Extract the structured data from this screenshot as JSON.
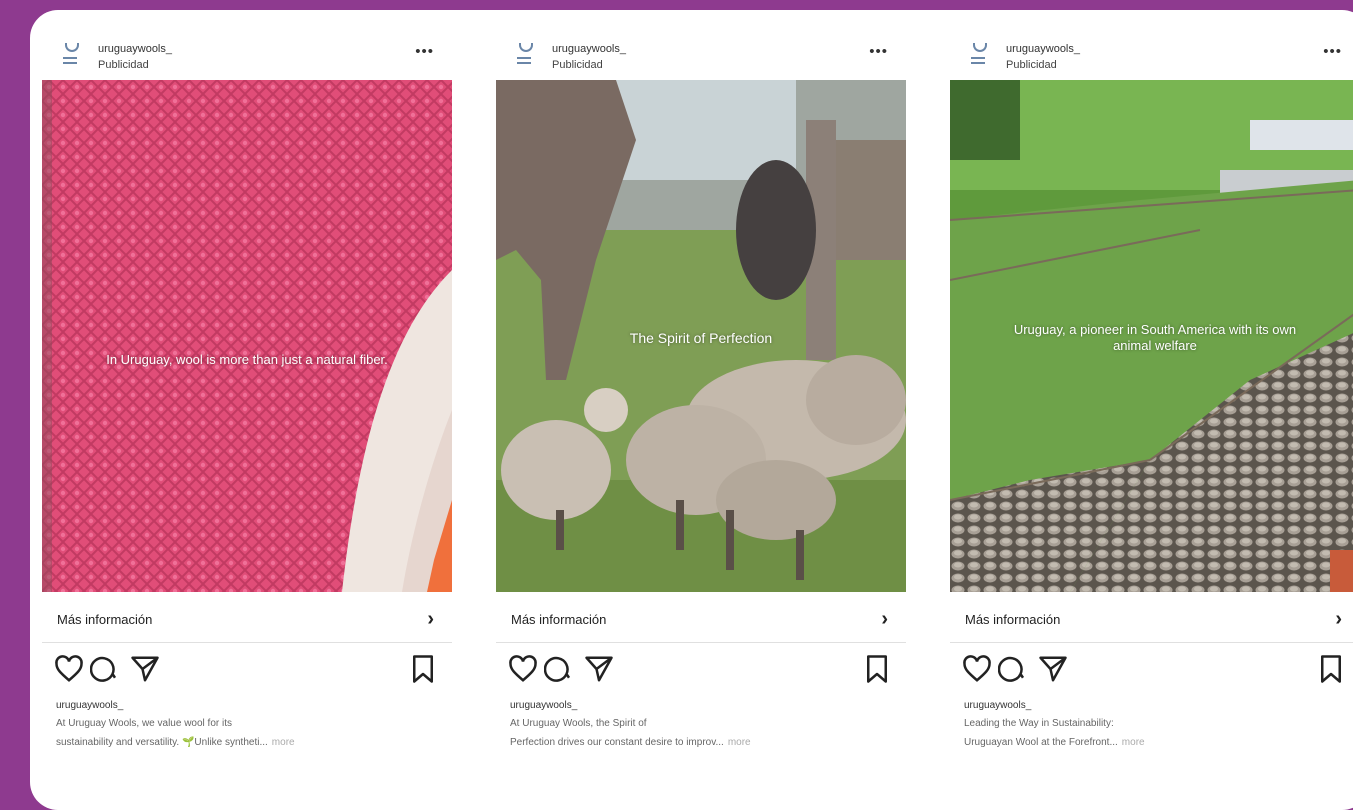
{
  "posts": [
    {
      "username": "uruguaywools_",
      "sponsored": "Publicidad",
      "overlay": "In Uruguay, wool is more than just a natural fiber.",
      "cta": "Más información",
      "caption_user": "uruguaywools_",
      "caption_line1": "At Uruguay Wools, we value wool for its",
      "caption_line2": "sustainability and versatility. 🌱Unlike syntheti...",
      "more": "more"
    },
    {
      "username": "uruguaywools_",
      "sponsored": "Publicidad",
      "overlay": "The Spirit of Perfection",
      "cta": "Más información",
      "caption_user": "uruguaywools_",
      "caption_line1": "At Uruguay Wools, the Spirit of",
      "caption_line2": "Perfection drives our constant desire to improv...",
      "more": "more"
    },
    {
      "username": "uruguaywools_",
      "sponsored": "Publicidad",
      "overlay": "Uruguay, a pioneer in South America with its own animal welfare",
      "cta": "Más información",
      "caption_user": "uruguaywools_",
      "caption_line1": "Leading the Way in Sustainability:",
      "caption_line2": "Uruguayan Wool at the Forefront...",
      "more": "more"
    }
  ],
  "icons": [
    "logo-icon",
    "more-options-icon",
    "chevron-right-icon",
    "heart-icon",
    "comment-icon",
    "share-icon",
    "bookmark-icon"
  ],
  "colors": {
    "background": "#8e3a8f",
    "card": "#ffffff",
    "knit": "#e0507a"
  }
}
